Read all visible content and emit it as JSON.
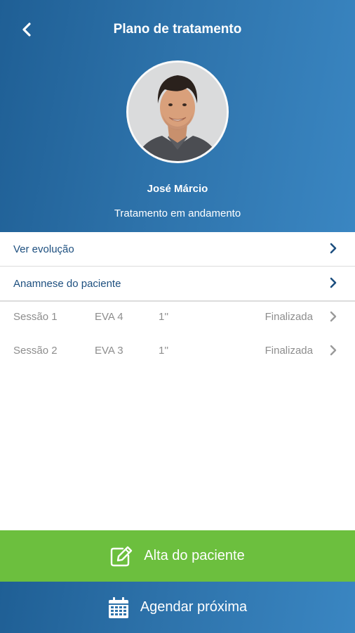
{
  "header": {
    "title": "Plano de tratamento",
    "patient_name": "José Márcio",
    "status": "Tratamento em andamento",
    "back_icon": "chevron-left-icon"
  },
  "menu": {
    "items": [
      {
        "label": "Ver evolução"
      },
      {
        "label": "Anamnese do paciente"
      }
    ]
  },
  "sessions": [
    {
      "name": "Sessão 1",
      "eva": "EVA 4",
      "duration": "1''",
      "status": "Finalizada"
    },
    {
      "name": "Sessão 2",
      "eva": "EVA 3",
      "duration": "1''",
      "status": "Finalizada"
    }
  ],
  "actions": {
    "discharge_label": "Alta do paciente",
    "schedule_label": "Agendar próxima"
  },
  "colors": {
    "primary_blue": "#2d72aa",
    "accent_green": "#6cbf3e",
    "link_text": "#1d4f7f",
    "muted_text": "#8d8d8d"
  }
}
